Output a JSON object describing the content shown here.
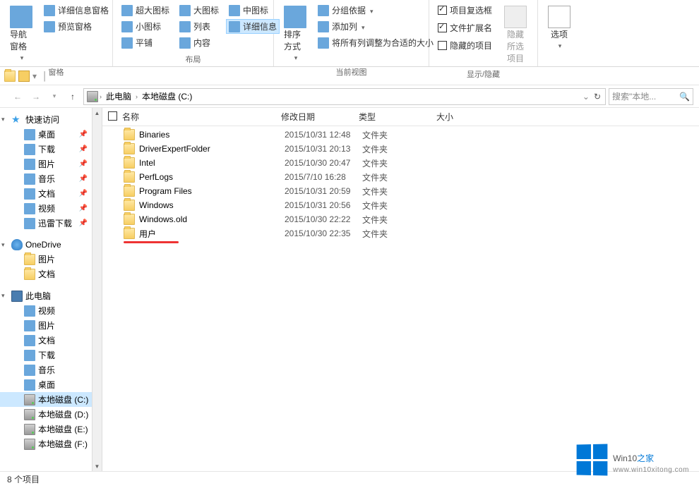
{
  "ribbon": {
    "panes": {
      "nav_pane": "导航窗格",
      "details_pane": "详细信息窗格",
      "preview_pane": "预览窗格",
      "label": "窗格"
    },
    "layout": {
      "extra_large": "超大图标",
      "large": "大图标",
      "medium": "中图标",
      "small": "小图标",
      "list": "列表",
      "details": "详细信息",
      "tiles": "平铺",
      "content": "内容",
      "label": "布局"
    },
    "current_view": {
      "sort_by": "排序方式",
      "group_by": "分组依据",
      "add_columns": "添加列",
      "fit_columns": "将所有列调整为合适的大小",
      "label": "当前视图"
    },
    "show_hide": {
      "item_checkboxes": "项目复选框",
      "file_ext": "文件扩展名",
      "hidden_items": "隐藏的项目",
      "hide_selected": "隐藏所选项目",
      "label": "显示/隐藏"
    },
    "options": {
      "label": "选项"
    }
  },
  "breadcrumb": {
    "this_pc": "此电脑",
    "drive": "本地磁盘 (C:)"
  },
  "search": {
    "placeholder": "搜索\"本地..."
  },
  "sidebar": {
    "quick_access": "快速访问",
    "items_quick": [
      {
        "label": "桌面",
        "icon": "desktop",
        "pin": true
      },
      {
        "label": "下载",
        "icon": "download",
        "pin": true
      },
      {
        "label": "图片",
        "icon": "pictures",
        "pin": true
      },
      {
        "label": "音乐",
        "icon": "music",
        "pin": true
      },
      {
        "label": "文档",
        "icon": "documents",
        "pin": true
      },
      {
        "label": "视频",
        "icon": "videos",
        "pin": true
      },
      {
        "label": "迅雷下载",
        "icon": "thunder",
        "pin": true
      }
    ],
    "onedrive": "OneDrive",
    "items_onedrive": [
      {
        "label": "图片"
      },
      {
        "label": "文档"
      }
    ],
    "this_pc": "此电脑",
    "items_pc": [
      {
        "label": "视频"
      },
      {
        "label": "图片"
      },
      {
        "label": "文档"
      },
      {
        "label": "下载"
      },
      {
        "label": "音乐"
      },
      {
        "label": "桌面"
      },
      {
        "label": "本地磁盘 (C:)",
        "selected": true,
        "icon": "drive"
      },
      {
        "label": "本地磁盘 (D:)",
        "icon": "drive"
      },
      {
        "label": "本地磁盘 (E:)",
        "icon": "drive"
      },
      {
        "label": "本地磁盘 (F:)",
        "icon": "drive"
      }
    ]
  },
  "columns": {
    "name": "名称",
    "date": "修改日期",
    "type": "类型",
    "size": "大小"
  },
  "rows": [
    {
      "name": "Binaries",
      "date": "2015/10/31 12:48",
      "type": "文件夹"
    },
    {
      "name": "DriverExpertFolder",
      "date": "2015/10/31 20:13",
      "type": "文件夹"
    },
    {
      "name": "Intel",
      "date": "2015/10/30 20:47",
      "type": "文件夹"
    },
    {
      "name": "PerfLogs",
      "date": "2015/7/10 16:28",
      "type": "文件夹"
    },
    {
      "name": "Program Files",
      "date": "2015/10/31 20:59",
      "type": "文件夹"
    },
    {
      "name": "Windows",
      "date": "2015/10/31 20:56",
      "type": "文件夹"
    },
    {
      "name": "Windows.old",
      "date": "2015/10/30 22:22",
      "type": "文件夹"
    },
    {
      "name": "用户",
      "date": "2015/10/30 22:35",
      "type": "文件夹"
    }
  ],
  "status": "8 个项目",
  "watermark": {
    "brand": "Win10",
    "suffix": "之家",
    "url": "www.win10xitong.com"
  }
}
